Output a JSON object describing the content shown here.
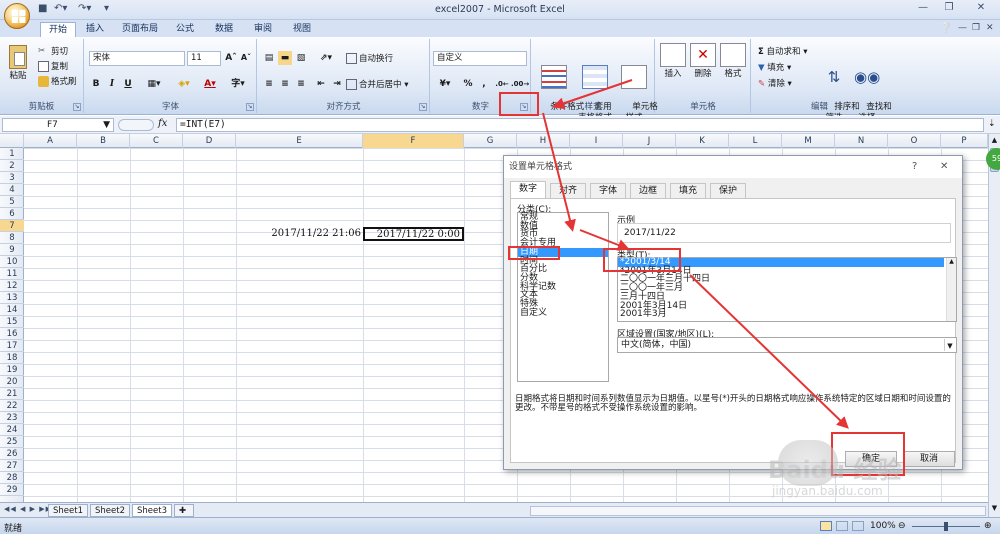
{
  "window": {
    "title": "excel2007 - Microsoft Excel"
  },
  "tabs": [
    "开始",
    "插入",
    "页面布局",
    "公式",
    "数据",
    "审阅",
    "视图"
  ],
  "ribbon": {
    "clipboard": {
      "label": "剪贴板",
      "paste": "粘贴",
      "cut": "剪切",
      "copy": "复制",
      "format_painter": "格式刷"
    },
    "font": {
      "label": "字体",
      "name": "宋体",
      "size": "11",
      "bold": "B",
      "italic": "I",
      "underline": "U",
      "font_color_glyph": "A"
    },
    "alignment": {
      "label": "对齐方式",
      "wrap": "自动换行",
      "merge": "合并后居中"
    },
    "number": {
      "label": "数字",
      "format": "自定义",
      "percent": "%",
      "comma": ","
    },
    "styles": {
      "label": "样式",
      "conditional": "条件格式",
      "table": "套用\n表格格式",
      "cell_styles": "单元格\n样式"
    },
    "cells": {
      "label": "单元格",
      "insert": "插入",
      "delete": "删除",
      "format": "格式"
    },
    "editing": {
      "label": "编辑",
      "autosum": "自动求和",
      "fill": "填充",
      "clear": "清除",
      "sort": "排序和\n筛选",
      "find": "查找和\n选择"
    }
  },
  "formula_bar": {
    "name_box": "F7",
    "fx": "fx",
    "formula": "=INT(E7)"
  },
  "grid": {
    "columns": [
      "A",
      "B",
      "C",
      "D",
      "E",
      "F",
      "G",
      "H",
      "I",
      "J",
      "K",
      "L",
      "M",
      "N",
      "O",
      "P"
    ],
    "rows": [
      "1",
      "2",
      "3",
      "4",
      "5",
      "6",
      "7",
      "8",
      "9",
      "10",
      "11",
      "12",
      "13",
      "14",
      "15",
      "16",
      "17",
      "18",
      "19",
      "20",
      "21",
      "22",
      "23",
      "24",
      "25",
      "26",
      "27",
      "28",
      "29"
    ],
    "cell_E7": "2017/11/22 21:06",
    "cell_F7": "2017/11/22 0:00"
  },
  "sheets": [
    "Sheet1",
    "Sheet2",
    "Sheet3"
  ],
  "status": {
    "mode": "就绪",
    "zoom": "100%"
  },
  "dialog": {
    "title": "设置单元格格式",
    "help": "?",
    "close": "✕",
    "tabs": [
      "数字",
      "对齐",
      "字体",
      "边框",
      "填充",
      "保护"
    ],
    "category_label": "分类(C):",
    "categories": [
      "常规",
      "数值",
      "货币",
      "会计专用",
      "日期",
      "时间",
      "百分比",
      "分数",
      "科学记数",
      "文本",
      "特殊",
      "自定义"
    ],
    "selected_category": "日期",
    "sample_label": "示例",
    "sample_value": "2017/11/22",
    "type_label": "类型(T):",
    "types": [
      "*2001/3/14",
      "*2001年3月14日",
      "二〇〇一年三月十四日",
      "二〇〇一年三月",
      "三月十四日",
      "2001年3月14日",
      "2001年3月"
    ],
    "locale_label": "区域设置(国家/地区)(L):",
    "locale_value": "中文(简体，中国)",
    "description": "日期格式将日期和时间系列数值显示为日期值。以星号(*)开头的日期格式响应操作系统特定的区域日期和时间设置的更改。不带星号的格式不受操作系统设置的影响。",
    "ok": "确定",
    "cancel": "取消"
  },
  "watermark": {
    "brand": "Baidu 经验",
    "url": "jingyan.baidu.com"
  },
  "badge": "59",
  "colors": {
    "annotation_red": "#e43434",
    "selection_blue": "#3399ff",
    "ribbon_blue": "#d6e2f3"
  }
}
